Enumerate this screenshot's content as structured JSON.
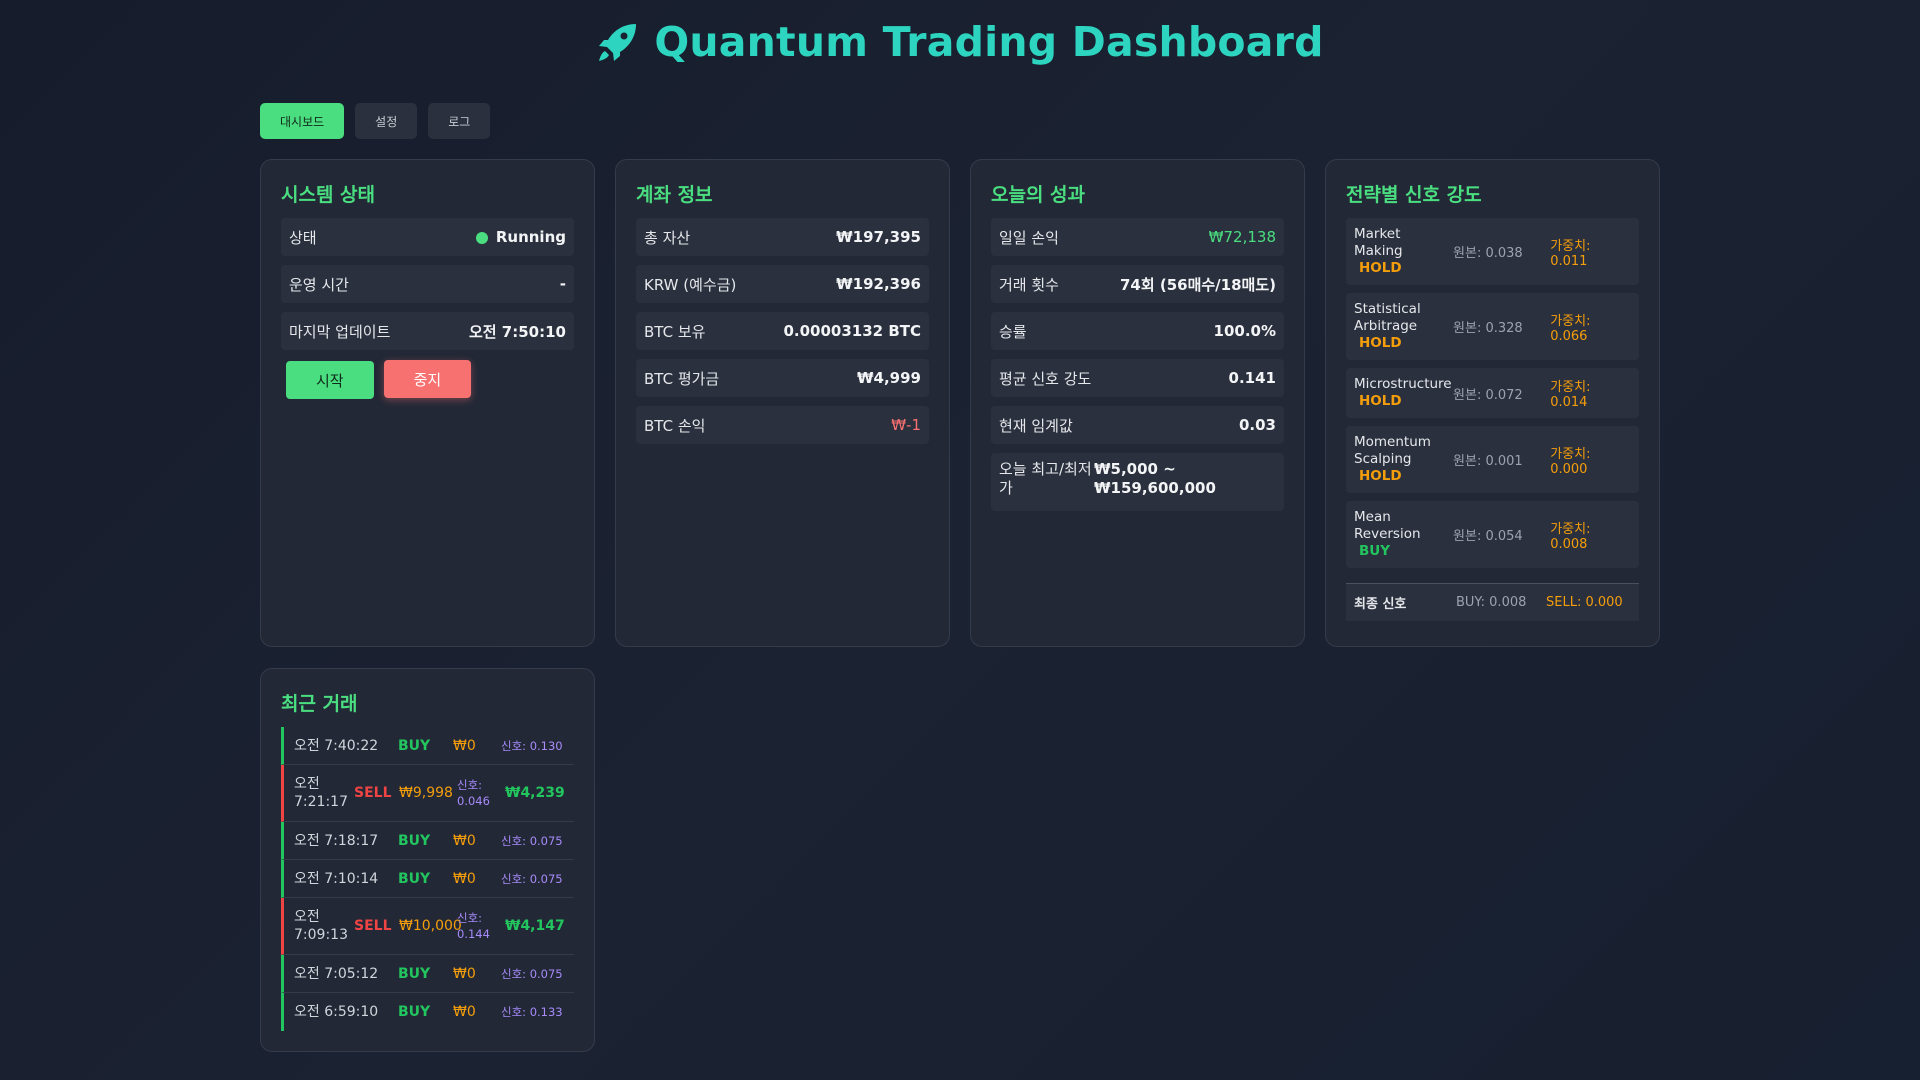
{
  "header": {
    "title": "Quantum Trading Dashboard"
  },
  "tabs": [
    {
      "label": "대시보드"
    },
    {
      "label": "설정"
    },
    {
      "label": "로그"
    }
  ],
  "system": {
    "title": "시스템 상태",
    "status_label": "상태",
    "status_value": "Running",
    "uptime_label": "운영 시간",
    "uptime_value": "-",
    "updated_label": "마지막 업데이트",
    "updated_value": "오전 7:50:10",
    "start_label": "시작",
    "stop_label": "중지"
  },
  "account": {
    "title": "계좌 정보",
    "rows": [
      {
        "label": "총 자산",
        "value": "₩197,395"
      },
      {
        "label": "KRW (예수금)",
        "value": "₩192,396"
      },
      {
        "label": "BTC 보유",
        "value": "0.00003132 BTC"
      },
      {
        "label": "BTC 평가금",
        "value": "₩4,999"
      },
      {
        "label": "BTC 손익",
        "value": "₩-1"
      }
    ]
  },
  "performance": {
    "title": "오늘의 성과",
    "rows": [
      {
        "label": "일일 손익",
        "value": "₩72,138"
      },
      {
        "label": "거래 횟수",
        "value": "74회 (56매수/18매도)"
      },
      {
        "label": "승률",
        "value": "100.0%"
      },
      {
        "label": "평균 신호 강도",
        "value": "0.141"
      },
      {
        "label": "현재 임계값",
        "value": "0.03"
      }
    ],
    "range_label": "오늘 최고/최저가",
    "range_value": "₩5,000 ~ ₩159,600,000"
  },
  "strategies": {
    "title": "전략별 신호 강도",
    "items": [
      {
        "name": "Market Making",
        "signal": "HOLD",
        "raw": "원본: 0.038",
        "weighted": "가중치: 0.011"
      },
      {
        "name": "Statistical Arbitrage",
        "signal": "HOLD",
        "raw": "원본: 0.328",
        "weighted": "가중치: 0.066"
      },
      {
        "name": "Microstructure",
        "signal": "HOLD",
        "raw": "원본: 0.072",
        "weighted": "가중치: 0.014"
      },
      {
        "name": "Momentum Scalping",
        "signal": "HOLD",
        "raw": "원본: 0.001",
        "weighted": "가중치: 0.000"
      },
      {
        "name": "Mean Reversion",
        "signal": "BUY",
        "raw": "원본: 0.054",
        "weighted": "가중치: 0.008"
      }
    ],
    "final_label": "최종 신호",
    "final_buy": "BUY: 0.008",
    "final_sell": "SELL: 0.000"
  },
  "trades": {
    "title": "최근 거래",
    "items": [
      {
        "time": "오전 7:40:22",
        "side": "BUY",
        "amount": "₩0",
        "signal": "신호: 0.130",
        "pnl": ""
      },
      {
        "time": "오전 7:21:17",
        "side": "SELL",
        "amount": "₩9,998",
        "signal": "신호: 0.046",
        "pnl": "₩4,239"
      },
      {
        "time": "오전 7:18:17",
        "side": "BUY",
        "amount": "₩0",
        "signal": "신호: 0.075",
        "pnl": ""
      },
      {
        "time": "오전 7:10:14",
        "side": "BUY",
        "amount": "₩0",
        "signal": "신호: 0.075",
        "pnl": ""
      },
      {
        "time": "오전 7:09:13",
        "side": "SELL",
        "amount": "₩10,000",
        "signal": "신호: 0.144",
        "pnl": "₩4,147"
      },
      {
        "time": "오전 7:05:12",
        "side": "BUY",
        "amount": "₩0",
        "signal": "신호: 0.075",
        "pnl": ""
      },
      {
        "time": "오전 6:59:10",
        "side": "BUY",
        "amount": "₩0",
        "signal": "신호: 0.133",
        "pnl": ""
      }
    ]
  },
  "colors": {
    "accent": "#4ade80",
    "title": "#2dd4bf",
    "loss": "#f87171",
    "hold": "#f59e0b",
    "signal": "#a78bfa"
  },
  "icons": {
    "header": "rocket-icon"
  }
}
